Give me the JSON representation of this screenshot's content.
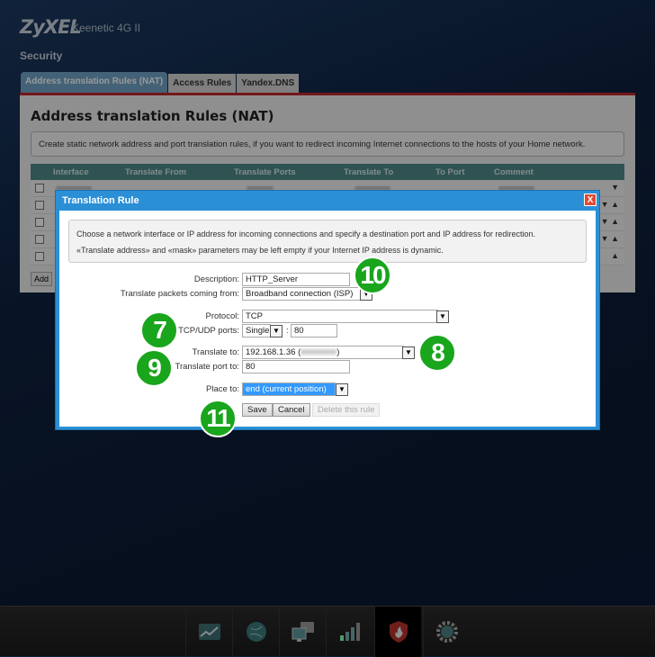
{
  "header": {
    "brand": "ZyXEL",
    "model": "Keenetic 4G II",
    "section": "Security"
  },
  "tabs": [
    {
      "label": "Address translation Rules (NAT)",
      "active": true
    },
    {
      "label": "Access Rules"
    },
    {
      "label": "Yandex.DNS"
    }
  ],
  "panel": {
    "title": "Address translation Rules (NAT)",
    "info": "Create static network address and port translation rules, if you want to redirect incoming Internet connections to the hosts of your Home network.",
    "columns": [
      "Interface",
      "Translate From",
      "Translate Ports",
      "Translate To",
      "To Port",
      "Comment"
    ],
    "add_label": "Add"
  },
  "modal": {
    "title": "Translation Rule",
    "close": "X",
    "info1": "Choose a network interface or IP address for incoming connections and specify a destination port and IP address for redirection.",
    "info2": "«Translate address» and «mask» parameters may be left empty if your Internet IP address is dynamic.",
    "description_label": "Description:",
    "description_value": "HTTP_Server",
    "from_label": "Translate packets coming from:",
    "from_value": "Broadband connection (ISP)",
    "protocol_label": "Protocol:",
    "protocol_value": "TCP",
    "ports_label": "TCP/UDP ports:",
    "ports_mode": "Single",
    "ports_sep": ":",
    "ports_value": "80",
    "to_label": "Translate to:",
    "to_value": "192.168.1.36 (",
    "to_suffix": ")",
    "port_to_label": "Translate port to:",
    "port_to_value": "80",
    "place_label": "Place to:",
    "place_value": "end (current position)",
    "save": "Save",
    "cancel": "Cancel",
    "delete": "Delete this rule"
  },
  "badges": [
    "7",
    "8",
    "9",
    "10",
    "11"
  ],
  "nav": [
    "chart-icon",
    "globe-icon",
    "computers-icon",
    "signal-icon",
    "firewall-icon",
    "gear-icon"
  ],
  "colors": {
    "accent": "#2b8fd6",
    "badge": "#19a51c",
    "tab_line": "#c0262b"
  }
}
